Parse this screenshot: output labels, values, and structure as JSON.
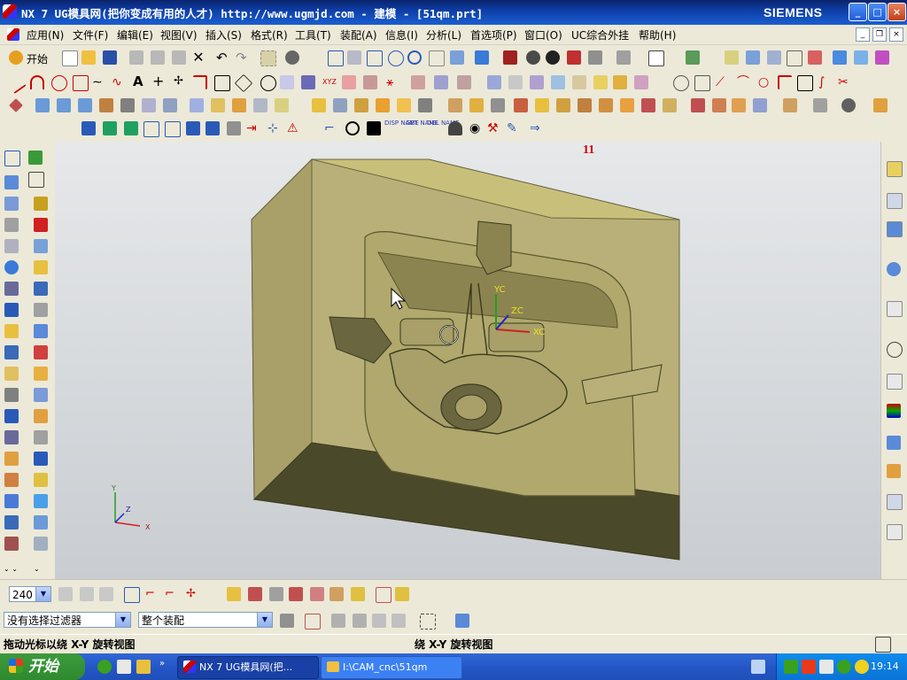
{
  "window": {
    "title": "NX 7 UG模具网(把你变成有用的人才) http://www.ugmjd.com - 建模 - [51qm.prt]",
    "brand": "SIEMENS",
    "controls": [
      "_",
      "□",
      "×"
    ]
  },
  "menu": {
    "items": [
      "应用(N)",
      "文件(F)",
      "编辑(E)",
      "视图(V)",
      "插入(S)",
      "格式(R)",
      "工具(T)",
      "装配(A)",
      "信息(I)",
      "分析(L)",
      "首选项(P)",
      "窗口(O)",
      "UC综合外挂",
      "帮助(H)"
    ]
  },
  "toolbar": {
    "start_label": "开始",
    "feature_labels": [
      "DISP NAME",
      "GET NAME",
      "DEL NAME"
    ]
  },
  "viewport": {
    "annotation": "11",
    "axes": {
      "yc": "YC",
      "zc": "ZC",
      "xc": "XC"
    },
    "triad": {
      "y": "Y",
      "z": "Z",
      "x": "X"
    },
    "model_color": "#c8c07a"
  },
  "bottombar": {
    "zoom_value": "240"
  },
  "selection": {
    "filter": "没有选择过滤器",
    "scope": "整个装配"
  },
  "status": {
    "left": "拖动光标以绕 X-Y 旋转视图",
    "center": "绕 X-Y 旋转视图"
  },
  "taskbar": {
    "start": "开始",
    "tasks": [
      "NX 7 UG模具网(把...",
      "I:\\CAM_cnc\\51qm"
    ],
    "clock": "19:14"
  }
}
